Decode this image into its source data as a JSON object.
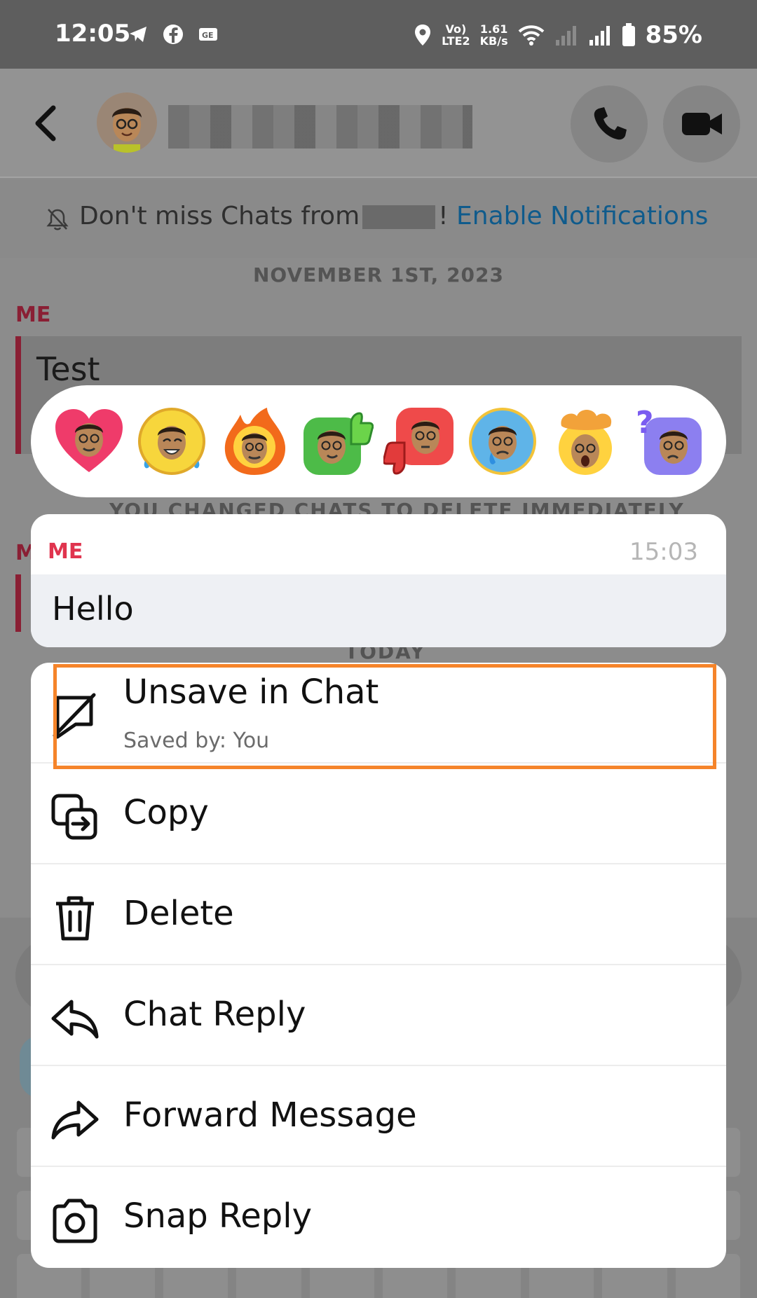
{
  "status_bar": {
    "time": "12:05",
    "network_label_top": "Vo)",
    "network_label_bottom": "LTE2",
    "speed_value": "1.61",
    "speed_unit": "KB/s",
    "battery": "85%"
  },
  "notification_bar": {
    "text_before": "Don't miss Chats from",
    "text_after": "!",
    "link": "Enable Notifications"
  },
  "chat": {
    "date_label": "NOVEMBER 1ST, 2023",
    "sender_label": "ME",
    "first_message": "Test",
    "ghost_notice": "YOU CHANGED CHATS TO DELETE IMMEDIATELY",
    "ghost_today": "TODAY",
    "ghost_m": "M"
  },
  "reactions": [
    "heart-bitmoji",
    "laughing-tears-bitmoji",
    "fire-bitmoji",
    "thumbs-up-bitmoji",
    "thumbs-down-bitmoji",
    "crying-bitmoji",
    "mind-blown-bitmoji",
    "question-bitmoji"
  ],
  "selected_message": {
    "sender": "ME",
    "time": "15:03",
    "text": "Hello"
  },
  "menu": {
    "unsave_label": "Unsave in Chat",
    "unsave_sub": "Saved by: You",
    "copy_label": "Copy",
    "delete_label": "Delete",
    "chat_reply_label": "Chat Reply",
    "forward_label": "Forward Message",
    "snap_reply_label": "Snap Reply"
  },
  "colors": {
    "highlight": "#f5842a",
    "me_label": "#e0344e",
    "link": "#0f5b8c"
  }
}
